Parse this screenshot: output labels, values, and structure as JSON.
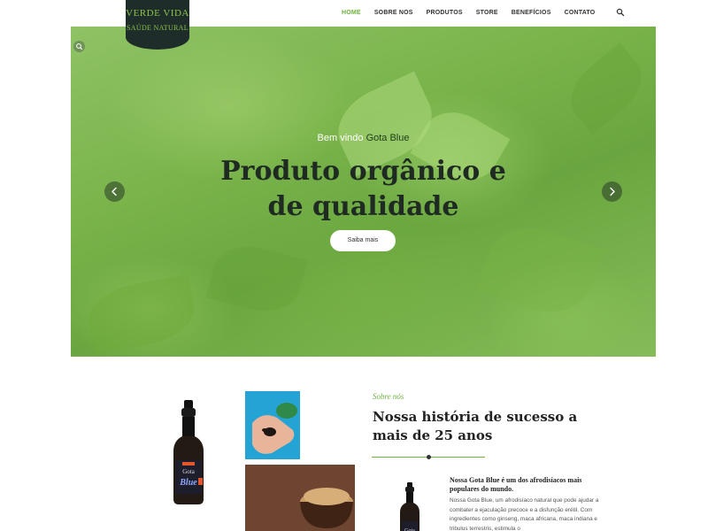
{
  "brand": {
    "name": "VERDE VIDA",
    "tagline": "SAÚDE NATURAL"
  },
  "nav": {
    "items": [
      {
        "label": "HOME",
        "active": true
      },
      {
        "label": "SOBRE NOS",
        "active": false
      },
      {
        "label": "PRODUTOS",
        "active": false
      },
      {
        "label": "STORE",
        "active": false
      },
      {
        "label": "BENEFÍCIOS",
        "active": false
      },
      {
        "label": "CONTATO",
        "active": false
      }
    ],
    "search_icon": "search-icon"
  },
  "hero": {
    "subtitle_prefix": "Bem vindo",
    "subtitle_highlight": "Gota Blue",
    "title_line1": "Produto orgânico e",
    "title_line2": "de qualidade",
    "button_label": "Saiba mais",
    "zoom_icon": "zoom-icon",
    "prev_icon": "chevron-left-icon",
    "next_icon": "chevron-right-icon"
  },
  "about": {
    "kicker": "Sobre nós",
    "title": "Nossa história de sucesso a mais de 25 anos",
    "lead": "Nossa Gota Blue é um dos afrodisíacos mais populares do mundo.",
    "body": "Nossa Gota Blue, um afrodisíaco natural que pode ajudar a combater a ejaculação precoce e a disfunção erétil. Com ingredientes como ginseng, maca africana, maca indiana e tribulus terrestris, estimula o",
    "product_label": "Gota Blue"
  },
  "colors": {
    "accent": "#6cb33f",
    "logo_bg": "#1f2d2a",
    "heading": "#1e2a22"
  }
}
